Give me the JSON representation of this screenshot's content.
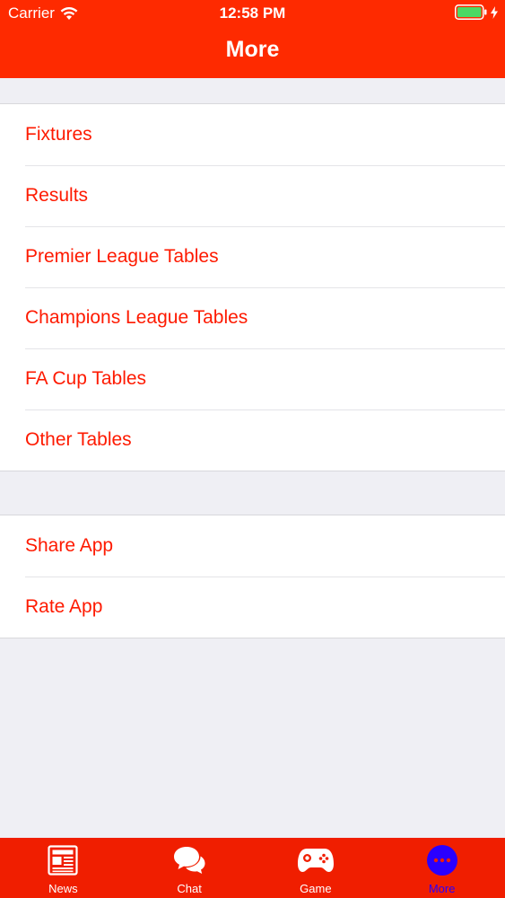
{
  "status_bar": {
    "carrier": "Carrier",
    "time": "12:58 PM"
  },
  "nav": {
    "title": "More"
  },
  "menu_group_1": [
    {
      "label": "Fixtures"
    },
    {
      "label": "Results"
    },
    {
      "label": "Premier League Tables"
    },
    {
      "label": "Champions League Tables"
    },
    {
      "label": "FA Cup Tables"
    },
    {
      "label": "Other Tables"
    }
  ],
  "menu_group_2": [
    {
      "label": "Share App"
    },
    {
      "label": "Rate App"
    }
  ],
  "tabs": [
    {
      "label": "News",
      "icon": "newspaper-icon"
    },
    {
      "label": "Chat",
      "icon": "chat-bubbles-icon"
    },
    {
      "label": "Game",
      "icon": "gamepad-icon"
    },
    {
      "label": "More",
      "icon": "more-dots-icon",
      "active": true
    }
  ],
  "colors": {
    "header": "#fe2a00",
    "tabbar": "#f01e00",
    "row_text": "#fe1a00",
    "active_tab": "#2a00ff",
    "background": "#efeff4",
    "battery": "#4cd964"
  }
}
